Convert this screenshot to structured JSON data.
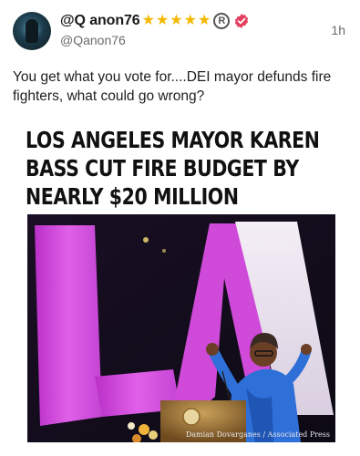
{
  "post": {
    "display_name": "@Q anon76",
    "star_count": 5,
    "star_glyph": "★",
    "registered_mark": "R",
    "handle": "@Qanon76",
    "timestamp": "1h",
    "text": "You get what you vote for....DEI mayor defunds fire fighters, what could go wrong?"
  },
  "media": {
    "headline_lines": [
      "LOS ANGELES MAYOR KAREN",
      "BASS CUT FIRE BUDGET BY",
      "NEARLY $20 MILLION"
    ],
    "photo_credit": "Damian Dovarganes / Associated Press"
  },
  "colors": {
    "star": "#f5b800",
    "verified_badge": "#e4405f",
    "magenta_sign": "#d648d6",
    "suit_blue": "#2f6fd8"
  },
  "icons": {
    "verified": "verified-badge-icon",
    "registered": "registered-icon",
    "star": "star-icon"
  }
}
